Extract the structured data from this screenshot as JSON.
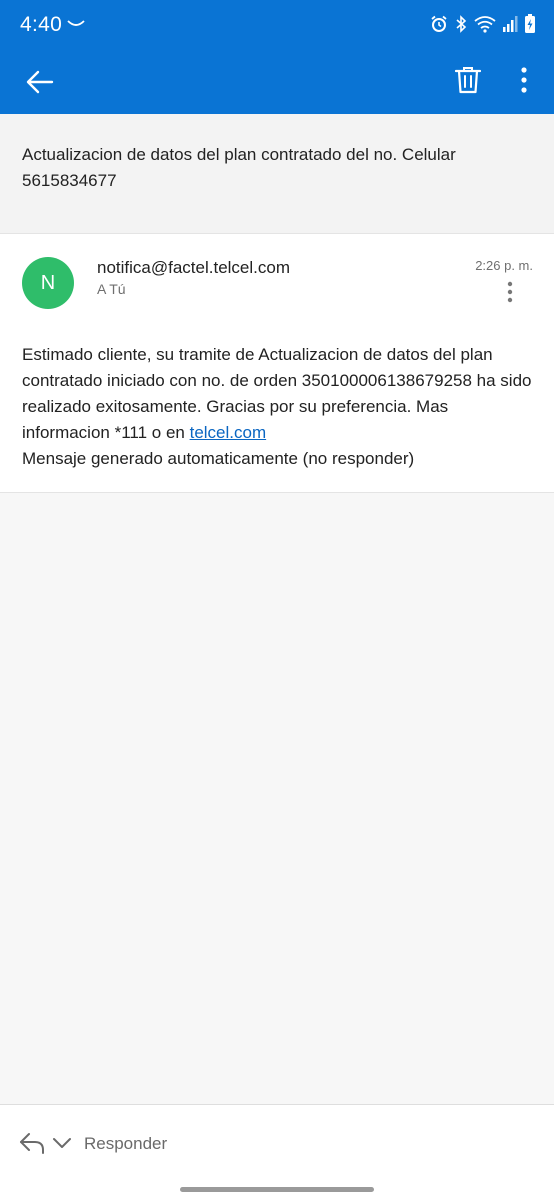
{
  "status_bar": {
    "time": "4:40",
    "icons": [
      "arc-icon",
      "alarm-icon",
      "bluetooth-icon",
      "wifi-icon",
      "signal-icon",
      "battery-charging-icon"
    ]
  },
  "app_bar": {
    "back_icon": "back-arrow-icon",
    "delete_icon": "trash-icon",
    "menu_icon": "more-vertical-icon"
  },
  "subject": "Actualizacion de datos del plan contratado del no. Celular 5615834677",
  "message": {
    "avatar_letter": "N",
    "avatar_color": "#2fbd6a",
    "sender": "notifica@factel.telcel.com",
    "recipient": "A Tú",
    "time": "2:26 p. m.",
    "body_part1": "Estimado cliente, su tramite de Actualizacion de datos del plan contratado iniciado con no. de orden 350100006138679258 ha sido realizado exitosamente. Gracias por su preferencia. Mas informacion *111 o en ",
    "link_text": "telcel.com",
    "body_part2": "Mensaje generado automaticamente (no responder)"
  },
  "reply_bar": {
    "label": "Responder"
  },
  "colors": {
    "brand_blue": "#0a74d4",
    "link_blue": "#0a66c2"
  }
}
